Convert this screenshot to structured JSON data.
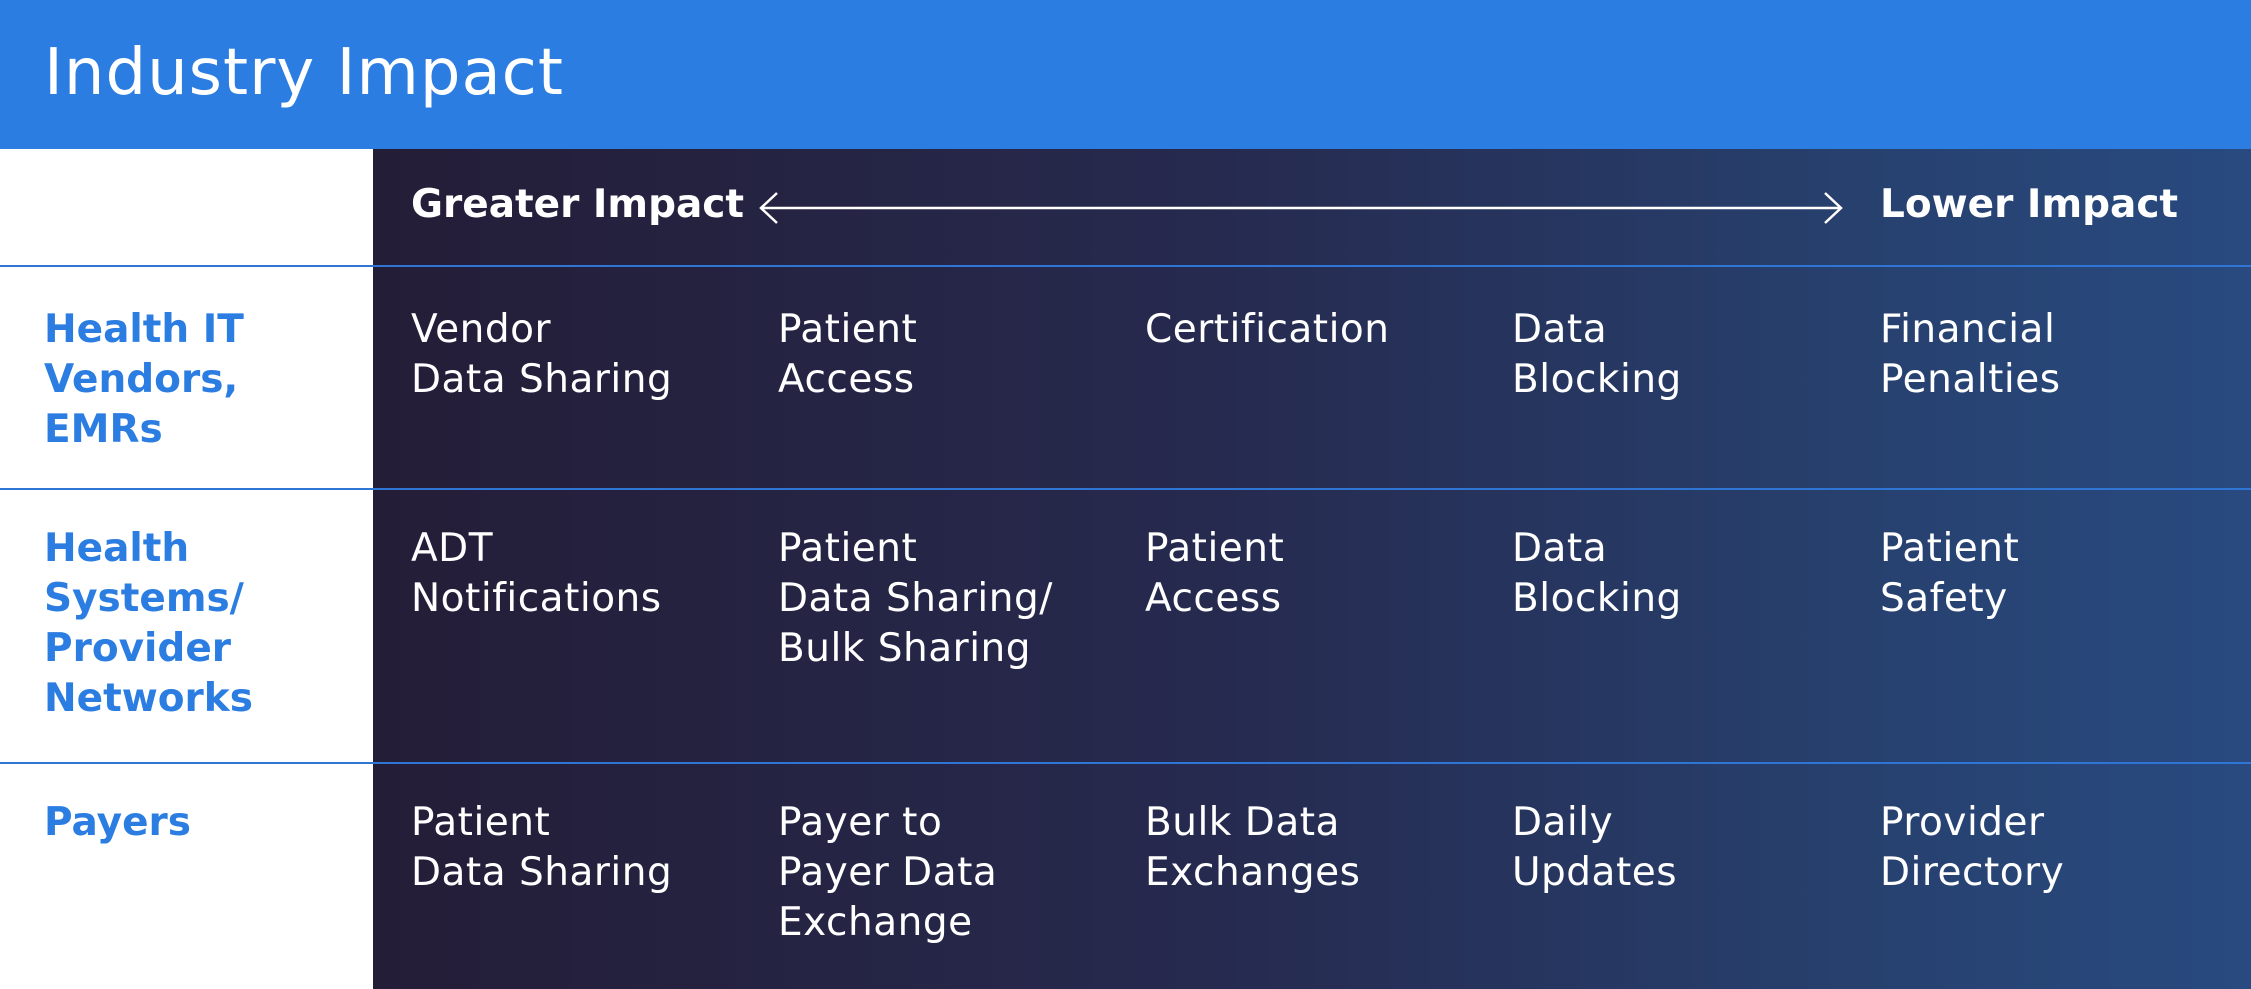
{
  "title": "Industry Impact",
  "scale": {
    "greater_label": "Greater Impact",
    "lower_label": "Lower Impact"
  },
  "rows": [
    {
      "label": "Health IT\nVendors,\nEMRs",
      "cells": [
        "Vendor\nData Sharing",
        "Patient\nAccess",
        "Certification",
        "Data\nBlocking",
        "Financial\nPenalties"
      ]
    },
    {
      "label": "Health\nSystems/\nProvider\nNetworks",
      "cells": [
        "ADT\nNotifications",
        "Patient\nData Sharing/\nBulk Sharing",
        "Patient\nAccess",
        "Data\nBlocking",
        "Patient\nSafety"
      ]
    },
    {
      "label": "Payers",
      "cells": [
        "Patient\nData Sharing",
        "Payer to\nPayer Data\nExchange",
        "Bulk Data\nExchanges",
        "Daily\nUpdates",
        "Provider\nDirectory"
      ]
    }
  ],
  "colors": {
    "header_blue": "#2b7de1",
    "label_blue": "#2b7de1",
    "divider": "#2f76d4",
    "panel_dark": "#241d37",
    "panel_light": "#284a80"
  }
}
